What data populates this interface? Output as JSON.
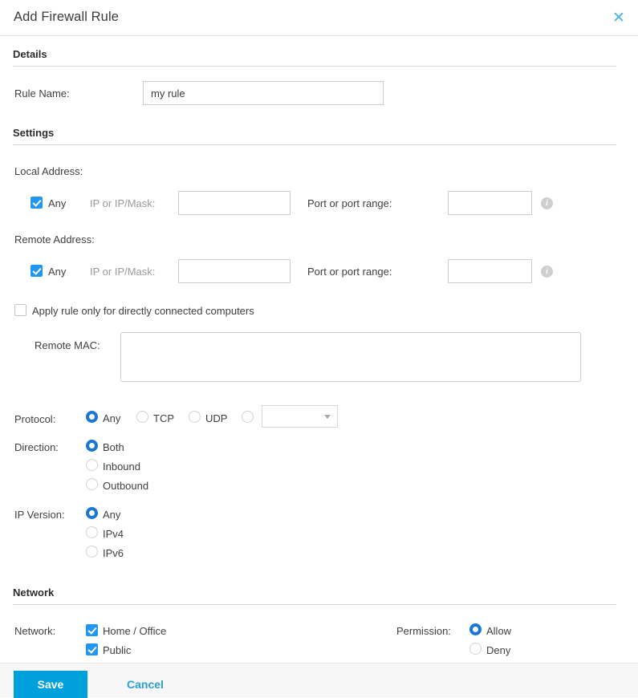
{
  "dialog": {
    "title": "Add Firewall Rule",
    "close_icon": "close-icon"
  },
  "sections": {
    "details": "Details",
    "settings": "Settings",
    "network": "Network"
  },
  "details": {
    "rule_name_label": "Rule Name:",
    "rule_name_value": "my rule",
    "rule_name_placeholder": ""
  },
  "settings": {
    "local_address_label": "Local Address:",
    "remote_address_label": "Remote Address:",
    "local": {
      "any_label": "Any",
      "any_checked": true,
      "ip_label": "IP or IP/Mask:",
      "ip_value": "",
      "port_label": "Port or port range:",
      "port_value": "",
      "info_icon": "info-icon"
    },
    "remote": {
      "any_label": "Any",
      "any_checked": true,
      "ip_label": "IP or IP/Mask:",
      "ip_value": "",
      "port_label": "Port or port range:",
      "port_value": "",
      "info_icon": "info-icon"
    },
    "directly_connected_label": "Apply rule only for directly connected computers",
    "directly_connected_checked": false,
    "remote_mac_label": "Remote MAC:",
    "remote_mac_value": "",
    "protocol": {
      "label": "Protocol:",
      "options": [
        {
          "label": "Any",
          "selected": true
        },
        {
          "label": "TCP",
          "selected": false
        },
        {
          "label": "UDP",
          "selected": false
        },
        {
          "label": "",
          "selected": false
        }
      ],
      "custom_select_value": ""
    },
    "direction": {
      "label": "Direction:",
      "options": [
        {
          "label": "Both",
          "selected": true
        },
        {
          "label": "Inbound",
          "selected": false
        },
        {
          "label": "Outbound",
          "selected": false
        }
      ]
    },
    "ip_version": {
      "label": "IP Version:",
      "options": [
        {
          "label": "Any",
          "selected": true
        },
        {
          "label": "IPv4",
          "selected": false
        },
        {
          "label": "IPv6",
          "selected": false
        }
      ]
    }
  },
  "network": {
    "label": "Network:",
    "options": [
      {
        "label": "Home / Office",
        "checked": true
      },
      {
        "label": "Public",
        "checked": true
      }
    ],
    "permission_label": "Permission:",
    "permission_options": [
      {
        "label": "Allow",
        "selected": true
      },
      {
        "label": "Deny",
        "selected": false
      }
    ]
  },
  "footer": {
    "save_label": "Save",
    "cancel_label": "Cancel"
  },
  "colors": {
    "accent": "#00a0dd",
    "link": "#2a9fd6",
    "checkbox": "#2196f3",
    "radio": "#1976d2"
  }
}
